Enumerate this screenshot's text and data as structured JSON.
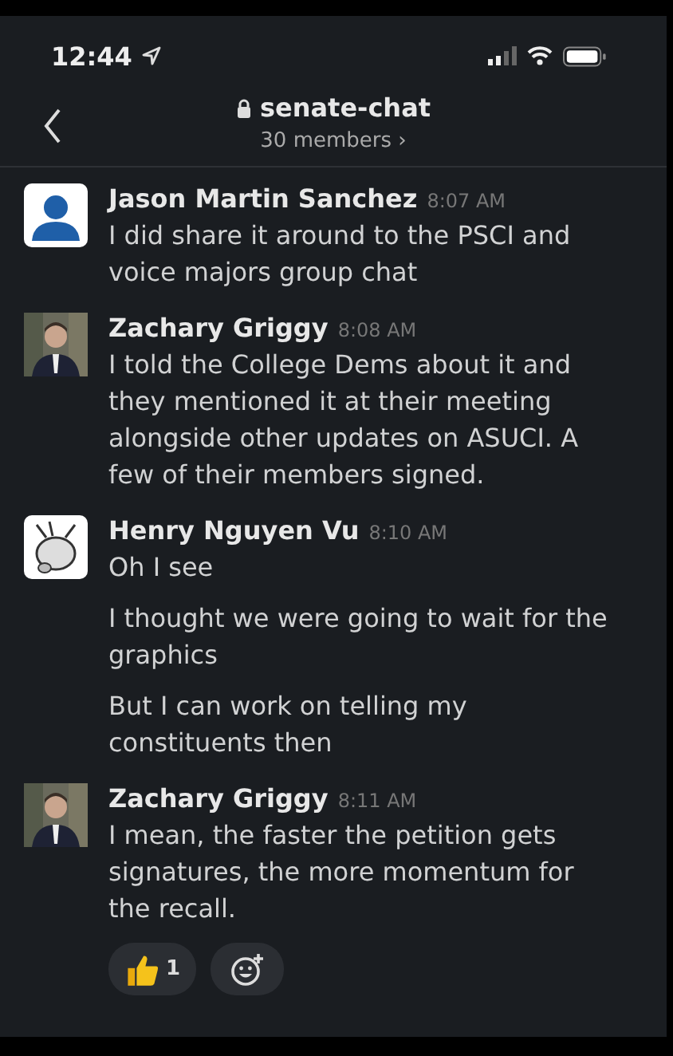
{
  "status_bar": {
    "time": "12:44"
  },
  "header": {
    "channel": "senate-chat",
    "members": "30 members ›"
  },
  "messages": [
    {
      "author": "Jason Martin Sanchez",
      "time": "8:07 AM",
      "avatar": {
        "kind": "default"
      },
      "paragraphs": [
        "I did share it around to the PSCI and voice majors group chat"
      ]
    },
    {
      "author": "Zachary Griggy",
      "time": "8:08 AM",
      "paragraphs": [
        "I told the College Dems about it and they mentioned it at their meeting alongside other updates on ASUCI. A few of their members signed."
      ]
    },
    {
      "author": "Henry Nguyen Vu",
      "time": "8:10 AM",
      "avatar": {
        "kind": "cartoon"
      },
      "paragraphs": [
        "Oh I see",
        "I thought we were going to wait for the graphics",
        "But I can work on telling my constituents then"
      ]
    },
    {
      "author": "Zachary Griggy",
      "time": "8:11 AM",
      "paragraphs": [
        "I mean, the faster the petition gets signatures, the more momentum for the recall."
      ],
      "reactions": [
        {
          "kind": "thumbs-up",
          "count": "1"
        }
      ]
    }
  ]
}
